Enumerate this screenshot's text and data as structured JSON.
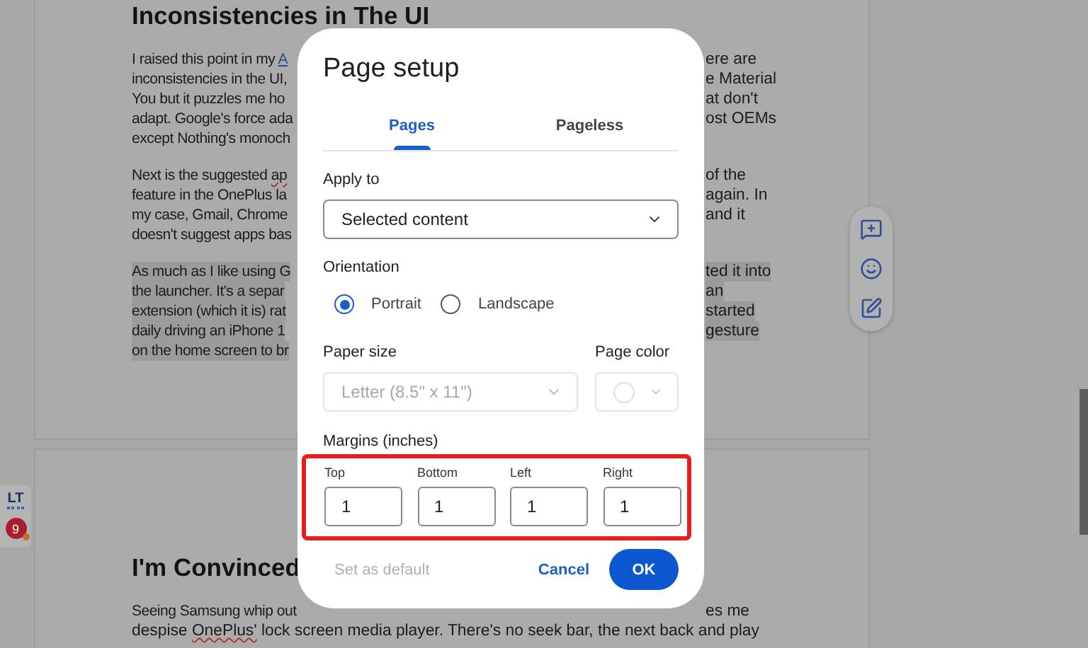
{
  "sidebar": {
    "logo": "LT",
    "badge": "9"
  },
  "document": {
    "pages": [
      {
        "heading": "Inconsistencies in The UI",
        "paragraphs": [
          {
            "highlighted": false,
            "lines": [
              {
                "left": [
                  {
                    "kind": "text",
                    "text": "I raised this point in my "
                  },
                  {
                    "kind": "link",
                    "text": "A"
                  }
                ],
                "right": "ere are"
              },
              {
                "left": [
                  {
                    "kind": "text",
                    "text": "inconsistencies in the UI,"
                  }
                ],
                "right": "e Material"
              },
              {
                "left": [
                  {
                    "kind": "text",
                    "text": "You but it puzzles me ho"
                  }
                ],
                "right": "at don't"
              },
              {
                "left": [
                  {
                    "kind": "text",
                    "text": "adapt. Google's force ada"
                  }
                ],
                "right": "ost OEMs"
              },
              {
                "left": [
                  {
                    "kind": "text",
                    "text": "except Nothing's monoch"
                  }
                ]
              }
            ]
          },
          {
            "highlighted": false,
            "lines": [
              {
                "left": [
                  {
                    "kind": "text",
                    "text": "Next is the suggested "
                  },
                  {
                    "kind": "misspelled",
                    "text": "ap"
                  }
                ],
                "right": "of the"
              },
              {
                "left": [
                  {
                    "kind": "text",
                    "text": "feature in the OnePlus la"
                  }
                ],
                "right": "again. In"
              },
              {
                "left": [
                  {
                    "kind": "text",
                    "text": "my case, Gmail, Chrome"
                  }
                ],
                "right": "and it"
              },
              {
                "left": [
                  {
                    "kind": "text",
                    "text": "doesn't suggest apps bas"
                  }
                ]
              }
            ]
          },
          {
            "highlighted": true,
            "lines": [
              {
                "left": [
                  {
                    "kind": "text",
                    "text": "As much as I like using G"
                  }
                ],
                "right": "ted it into"
              },
              {
                "left": [
                  {
                    "kind": "text",
                    "text": "the launcher. It's a separ"
                  }
                ],
                "right": "an"
              },
              {
                "left": [
                  {
                    "kind": "text",
                    "text": "extension (which it is) rat"
                  }
                ],
                "right": "started"
              },
              {
                "left": [
                  {
                    "kind": "text",
                    "text": "daily driving an iPhone 1"
                  }
                ],
                "right": "gesture"
              },
              {
                "left": [
                  {
                    "kind": "text",
                    "text": "on the home screen to br"
                  }
                ]
              }
            ]
          }
        ]
      },
      {
        "heading": "I'm Convinced",
        "paragraphs": [
          {
            "highlighted": false,
            "lines": [
              {
                "left": [
                  {
                    "kind": "text",
                    "text": "Seeing Samsung whip out"
                  }
                ],
                "right": "es me"
              },
              {
                "full": [
                  {
                    "kind": "text",
                    "text": "despise "
                  },
                  {
                    "kind": "misspelled",
                    "text": "OnePlus'"
                  },
                  {
                    "kind": "text",
                    "text": " lock screen media player. There's no seek bar, the next back and play"
                  }
                ]
              }
            ]
          }
        ]
      }
    ]
  },
  "dialog": {
    "title": "Page setup",
    "tabs": [
      {
        "label": "Pages",
        "selected": true
      },
      {
        "label": "Pageless",
        "selected": false
      }
    ],
    "apply_to": {
      "label": "Apply to",
      "value": "Selected content"
    },
    "orientation": {
      "label": "Orientation",
      "options": [
        {
          "label": "Portrait",
          "selected": true
        },
        {
          "label": "Landscape",
          "selected": false
        }
      ]
    },
    "paper_size": {
      "label": "Paper size",
      "value": "Letter (8.5\" x 11\")",
      "disabled": true
    },
    "page_color": {
      "label": "Page color",
      "disabled": true
    },
    "margins": {
      "label": "Margins (inches)",
      "highlighted": true,
      "fields": [
        {
          "label": "Top",
          "value": "1"
        },
        {
          "label": "Bottom",
          "value": "1"
        },
        {
          "label": "Left",
          "value": "1"
        },
        {
          "label": "Right",
          "value": "1"
        }
      ]
    },
    "buttons": [
      {
        "label": "Set as default",
        "kind": "text",
        "disabled": true
      },
      {
        "label": "Cancel",
        "kind": "text",
        "disabled": false
      },
      {
        "label": "OK",
        "kind": "primary",
        "disabled": false
      }
    ]
  }
}
